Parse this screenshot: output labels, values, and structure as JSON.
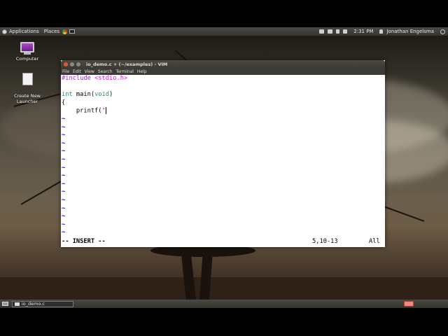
{
  "top_panel": {
    "applications": "Applications",
    "places": "Places",
    "time": "2:31 PM",
    "user": "Jonathan Engelsma"
  },
  "desktop": {
    "icons": [
      {
        "label": "Computer"
      },
      {
        "label": "Create New\nLauncher"
      }
    ]
  },
  "vim": {
    "title": "io_demo.c + (~/examples) - VIM",
    "menu": [
      "File",
      "Edit",
      "View",
      "Search",
      "Terminal",
      "Help"
    ],
    "code": {
      "line1_pre": "#include ",
      "line1_inc": "<stdio.h>",
      "line3_type": "int",
      "line3_rest": " main(",
      "line3_type2": "void",
      "line3_end": ")",
      "line4": "{",
      "line5_code": "    printf(",
      "line5_str": "\""
    },
    "tilde": "~",
    "status": {
      "mode": "-- INSERT --",
      "position": "5,10-13",
      "scroll": "All"
    }
  },
  "bottom_panel": {
    "task_label": "io_demo.c"
  },
  "colors": {
    "vim_preproc": "#a020f0",
    "vim_string": "#ff00ff",
    "vim_type": "#2e8b57",
    "vim_tilde": "#0000ff",
    "panel": "#3c3b37"
  }
}
